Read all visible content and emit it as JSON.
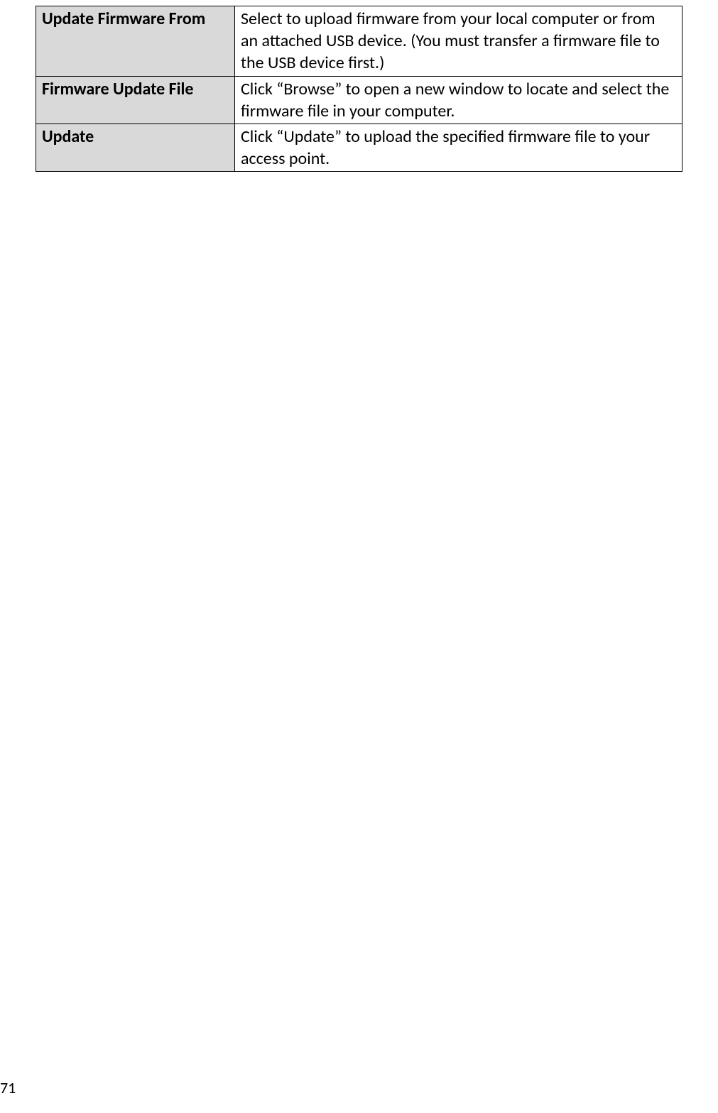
{
  "table": {
    "rows": [
      {
        "label": "Update Firmware From",
        "description": "Select to upload firmware from your local computer or from an attached USB device. (You must transfer a firmware file to the USB device first.)"
      },
      {
        "label": "Firmware Update File",
        "description": "Click “Browse” to open a new window to locate and select the firmware file in your computer."
      },
      {
        "label": "Update",
        "description": "Click “Update” to upload the specified firmware file to your access point."
      }
    ]
  },
  "page_number": "71"
}
